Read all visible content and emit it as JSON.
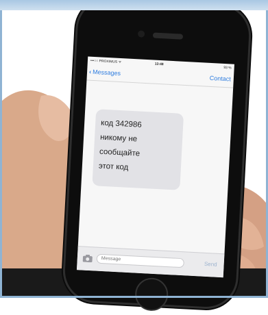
{
  "status_bar": {
    "carrier": "•••○○ PROXIMUS ᯤ",
    "time": "13:48",
    "battery": "93 %"
  },
  "navbar": {
    "back_label": "Messages",
    "contact_label": "Contact"
  },
  "message": {
    "text": "код 342986\nникому не\nсообщайте\nэтот код"
  },
  "compose": {
    "placeholder": "Message",
    "send_label": "Send"
  },
  "icons": {
    "back": "chevron-left-icon",
    "camera": "camera-icon"
  },
  "colors": {
    "accent": "#2f7ddf",
    "bubble": "#e2e2e6",
    "frame": "#8fb3d3"
  }
}
